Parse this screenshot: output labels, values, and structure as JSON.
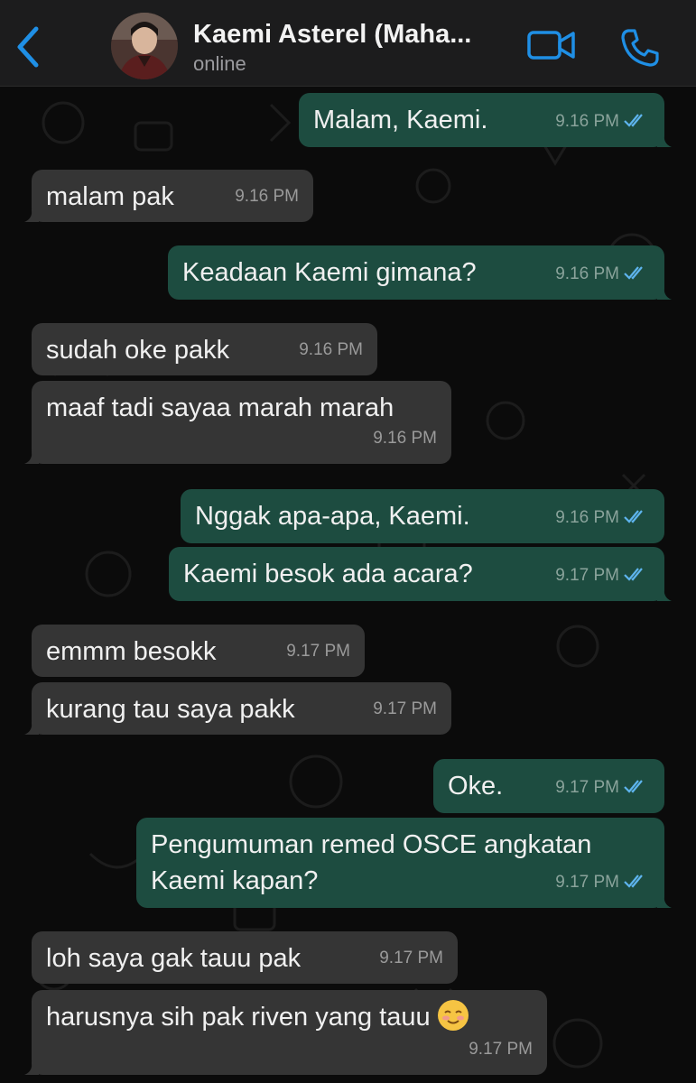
{
  "header": {
    "contact_name": "Kaemi Asterel (Maha...",
    "status": "online"
  },
  "icons": {
    "back": "chevron-left-icon",
    "video": "video-camera-icon",
    "call": "phone-icon",
    "read_receipt": "double-check-icon"
  },
  "colors": {
    "accent": "#1f8fe5",
    "incoming_bubble": "#353535",
    "outgoing_bubble": "#1d4c40",
    "read_tick": "#5eb4ee"
  },
  "messages": [
    {
      "dir": "out",
      "text": "Malam, Kaemi.",
      "time": "9.16 PM"
    },
    {
      "dir": "in",
      "text": "malam pak",
      "time": "9.16 PM"
    },
    {
      "dir": "out",
      "text": "Keadaan Kaemi gimana?",
      "time": "9.16 PM"
    },
    {
      "dir": "in",
      "text": "sudah oke pakk",
      "time": "9.16 PM"
    },
    {
      "dir": "in",
      "text": "maaf tadi sayaa marah marah",
      "time": "9.16 PM"
    },
    {
      "dir": "out",
      "text": "Nggak apa-apa, Kaemi.",
      "time": "9.16 PM"
    },
    {
      "dir": "out",
      "text": "Kaemi besok ada acara?",
      "time": "9.17 PM"
    },
    {
      "dir": "in",
      "text": "emmm besokk",
      "time": "9.17 PM"
    },
    {
      "dir": "in",
      "text": "kurang tau saya pakk",
      "time": "9.17 PM"
    },
    {
      "dir": "out",
      "text": "Oke.",
      "time": "9.17 PM"
    },
    {
      "dir": "out",
      "text": "Pengumuman remed OSCE angkatan Kaemi kapan?",
      "time": "9.17 PM"
    },
    {
      "dir": "in",
      "text": "loh saya gak tauu pak",
      "time": "9.17 PM"
    },
    {
      "dir": "in",
      "text": "harusnya sih pak riven yang tauu",
      "emoji": "smiling-face-icon",
      "time": "9.17 PM"
    }
  ]
}
